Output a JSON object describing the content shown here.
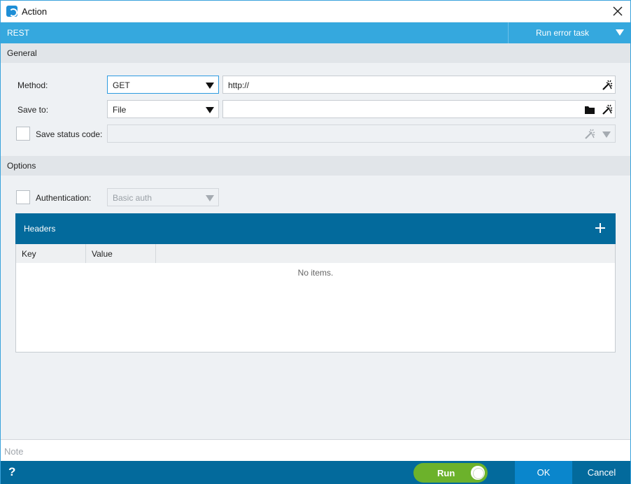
{
  "window": {
    "title": "Action"
  },
  "action_bar": {
    "action_name": "REST",
    "error_task_label": "Run error task"
  },
  "general": {
    "section_title": "General",
    "method_label": "Method:",
    "method_value": "GET",
    "url_value": "http://",
    "save_to_label": "Save to:",
    "save_to_value": "File",
    "save_path_value": "",
    "save_status_label": "Save status code:",
    "save_status_checked": false
  },
  "options": {
    "section_title": "Options",
    "auth_label": "Authentication:",
    "auth_checked": false,
    "auth_value": "Basic auth"
  },
  "headers": {
    "title": "Headers",
    "columns": [
      "Key",
      "Value"
    ],
    "empty_text": "No items."
  },
  "note": {
    "placeholder": "Note"
  },
  "footer": {
    "help_label": "?",
    "run_label": "Run",
    "run_enabled": true,
    "ok_label": "OK",
    "cancel_label": "Cancel"
  },
  "colors": {
    "accent": "#35a8de",
    "footer": "#036a9c",
    "ok_button": "#0a86cc",
    "run_toggle": "#6cb22b"
  },
  "icons": {
    "app": "app-logo-icon",
    "close": "close-icon",
    "dropdown": "chevron-down-icon",
    "variables": "magic-wand-icon",
    "folder": "folder-icon",
    "add": "plus-icon"
  }
}
